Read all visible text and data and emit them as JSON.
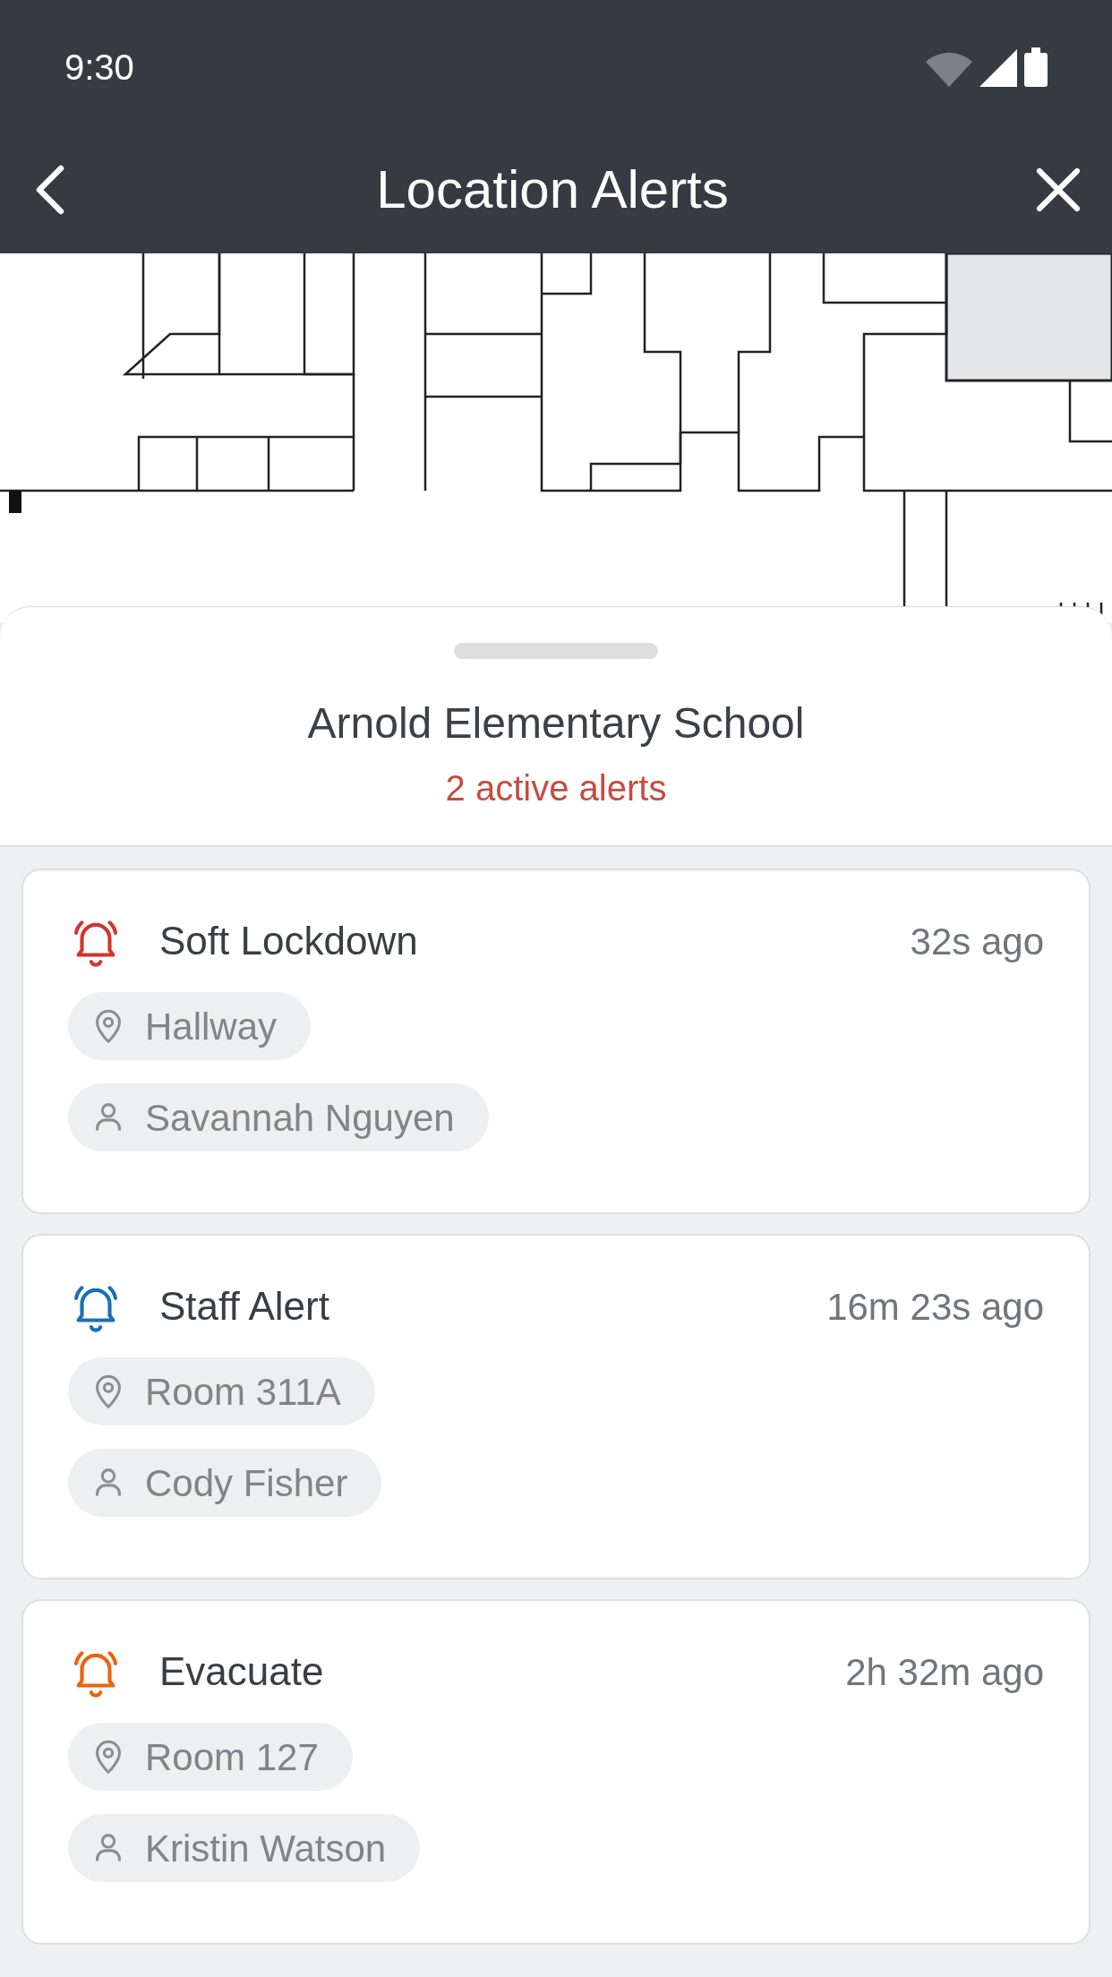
{
  "status_bar": {
    "time": "9:30"
  },
  "header": {
    "title": "Location Alerts"
  },
  "sheet": {
    "title": "Arnold Elementary School",
    "subtitle": "2 active alerts"
  },
  "alerts": [
    {
      "title": "Soft Lockdown",
      "time": "32s ago",
      "color": "#d3342e",
      "location": "Hallway",
      "person": "Savannah Nguyen"
    },
    {
      "title": "Staff Alert",
      "time": "16m 23s ago",
      "color": "#1a6fb8",
      "location": "Room 311A",
      "person": "Cody Fisher"
    },
    {
      "title": "Evacuate",
      "time": "2h 32m ago",
      "color": "#ea640f",
      "location": "Room 127",
      "person": "Kristin Watson"
    }
  ]
}
